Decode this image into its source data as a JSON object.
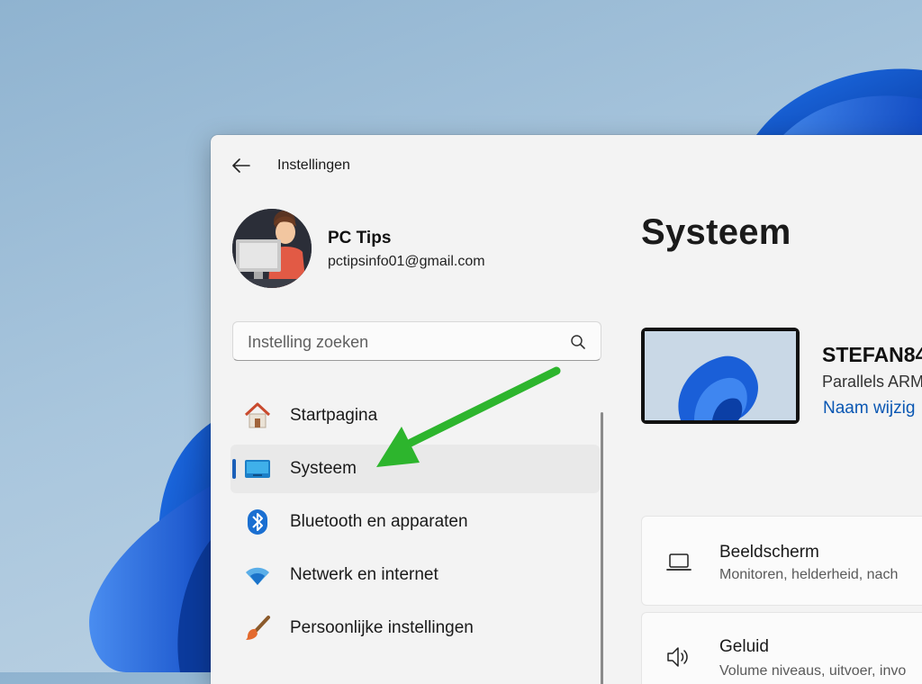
{
  "app": {
    "title": "Instellingen"
  },
  "user": {
    "name": "PC Tips",
    "email": "pctipsinfo01@gmail.com"
  },
  "search": {
    "placeholder": "Instelling zoeken"
  },
  "nav": {
    "items": [
      {
        "label": "Startpagina",
        "icon": "home-icon"
      },
      {
        "label": "Systeem",
        "icon": "system-monitor-icon",
        "active": true
      },
      {
        "label": "Bluetooth en apparaten",
        "icon": "bluetooth-icon"
      },
      {
        "label": "Netwerk en internet",
        "icon": "wifi-icon"
      },
      {
        "label": "Persoonlijke instellingen",
        "icon": "paintbrush-icon"
      }
    ]
  },
  "main": {
    "title": "Systeem",
    "device": {
      "name": "STEFAN84",
      "model": "Parallels ARM",
      "rename_link": "Naam wijzig"
    },
    "cards": [
      {
        "title": "Beeldscherm",
        "subtitle": "Monitoren, helderheid, nach",
        "icon": "laptop-icon"
      },
      {
        "title": "Geluid",
        "subtitle": "Volume niveaus, uitvoer, invo",
        "icon": "speaker-icon"
      }
    ]
  },
  "colors": {
    "accent": "#1b5fb8",
    "link": "#0a57b3",
    "arrow": "#2db52d",
    "window_bg": "#f3f3f3"
  }
}
